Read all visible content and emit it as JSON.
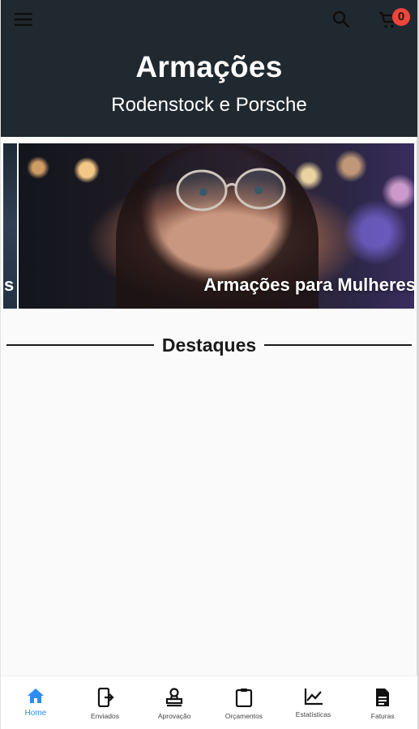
{
  "header": {
    "title": "Armações",
    "subtitle": "Rodenstock e Porsche",
    "cart_count": "0"
  },
  "carousel": {
    "prev_label": "s",
    "current_label": "Armações para Mulheres"
  },
  "section": {
    "title": "Destaques"
  },
  "bottom_nav": [
    {
      "label": "Home",
      "icon": "home-icon",
      "active": true
    },
    {
      "label": "Enviados",
      "icon": "send-to-mobile-icon",
      "active": false
    },
    {
      "label": "Aprovação",
      "icon": "stamp-icon",
      "active": false
    },
    {
      "label": "Orçamentos",
      "icon": "clipboard-icon",
      "active": false
    },
    {
      "label": "Estatísticas",
      "icon": "chart-line-icon",
      "active": false
    },
    {
      "label": "Faturas",
      "icon": "document-icon",
      "active": false
    }
  ],
  "colors": {
    "header_bg": "#212930",
    "accent": "#2d8cf0",
    "badge": "#f1453b"
  }
}
